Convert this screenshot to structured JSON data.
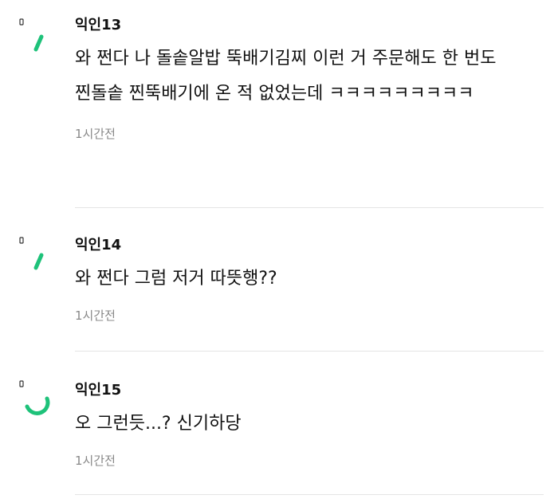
{
  "colors": {
    "accent": "#1ec27a",
    "divider": "#e5e5e5",
    "muted_text": "#888888"
  },
  "comments": [
    {
      "author": "익인13",
      "text": "와 쩐다 나 돌솥알밥 뚝배기김찌 이런 거 주문해도 한 번도 찐돌솥 찐뚝배기에 온 적 없었는데 ㅋㅋㅋㅋㅋㅋㅋㅋㅋ",
      "time": "1시간전",
      "indicator_icon": "loading-spinner-icon"
    },
    {
      "author": "익인14",
      "text": "와 쩐다 그럼 저거 따뜻행??",
      "time": "1시간전",
      "indicator_icon": "loading-spinner-icon"
    },
    {
      "author": "익인15",
      "text": "오 그런듯...? 신기하당",
      "time": "1시간전",
      "indicator_icon": "loading-spinner-icon"
    }
  ]
}
